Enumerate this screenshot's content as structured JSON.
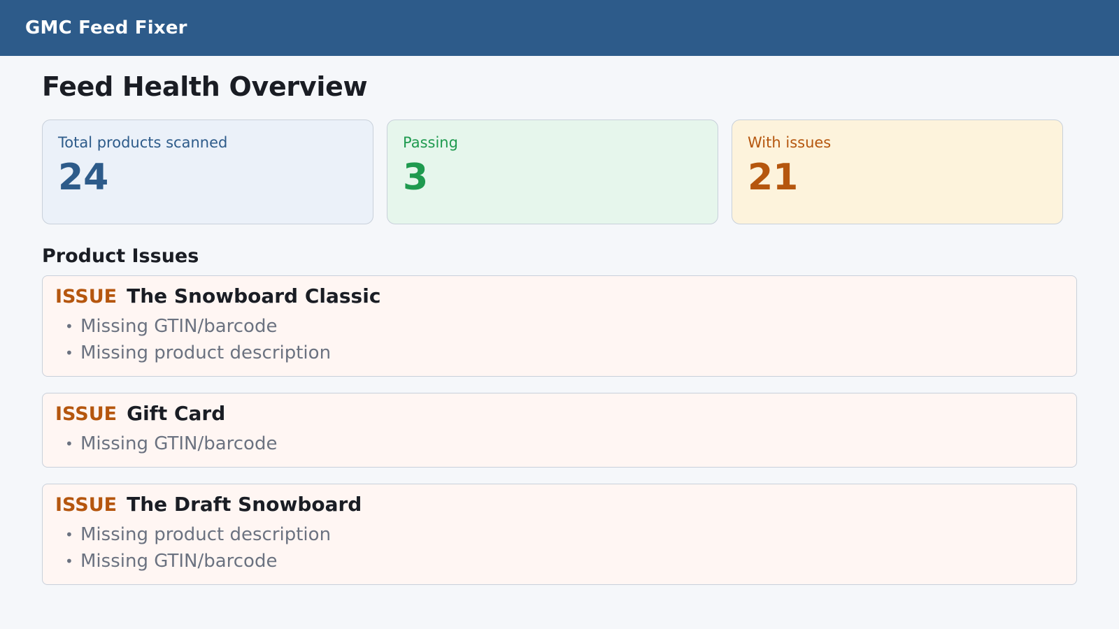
{
  "header": {
    "app_title": "GMC Feed Fixer"
  },
  "main": {
    "page_title": "Feed Health Overview",
    "stats": [
      {
        "key": "total",
        "label": "Total products scanned",
        "value": "24",
        "color": "#2d5b8a"
      },
      {
        "key": "passing",
        "label": "Passing",
        "value": "3",
        "color": "#1f9a4f"
      },
      {
        "key": "issues",
        "label": "With issues",
        "value": "21",
        "color": "#b5560e"
      }
    ],
    "section_title": "Product Issues",
    "issue_tag": "ISSUE",
    "issues": [
      {
        "product": "The Snowboard Classic",
        "problems": [
          "Missing GTIN/barcode",
          "Missing product description"
        ]
      },
      {
        "product": "Gift Card",
        "problems": [
          "Missing GTIN/barcode"
        ]
      },
      {
        "product": "The Draft Snowboard",
        "problems": [
          "Missing product description",
          "Missing GTIN/barcode"
        ]
      }
    ]
  },
  "colors": {
    "header_bg": "#2d5b8a",
    "issue_accent": "#b5560e",
    "pass_accent": "#1f9a4f"
  },
  "icons": {
    "list_bullet": "bullet-dot"
  }
}
